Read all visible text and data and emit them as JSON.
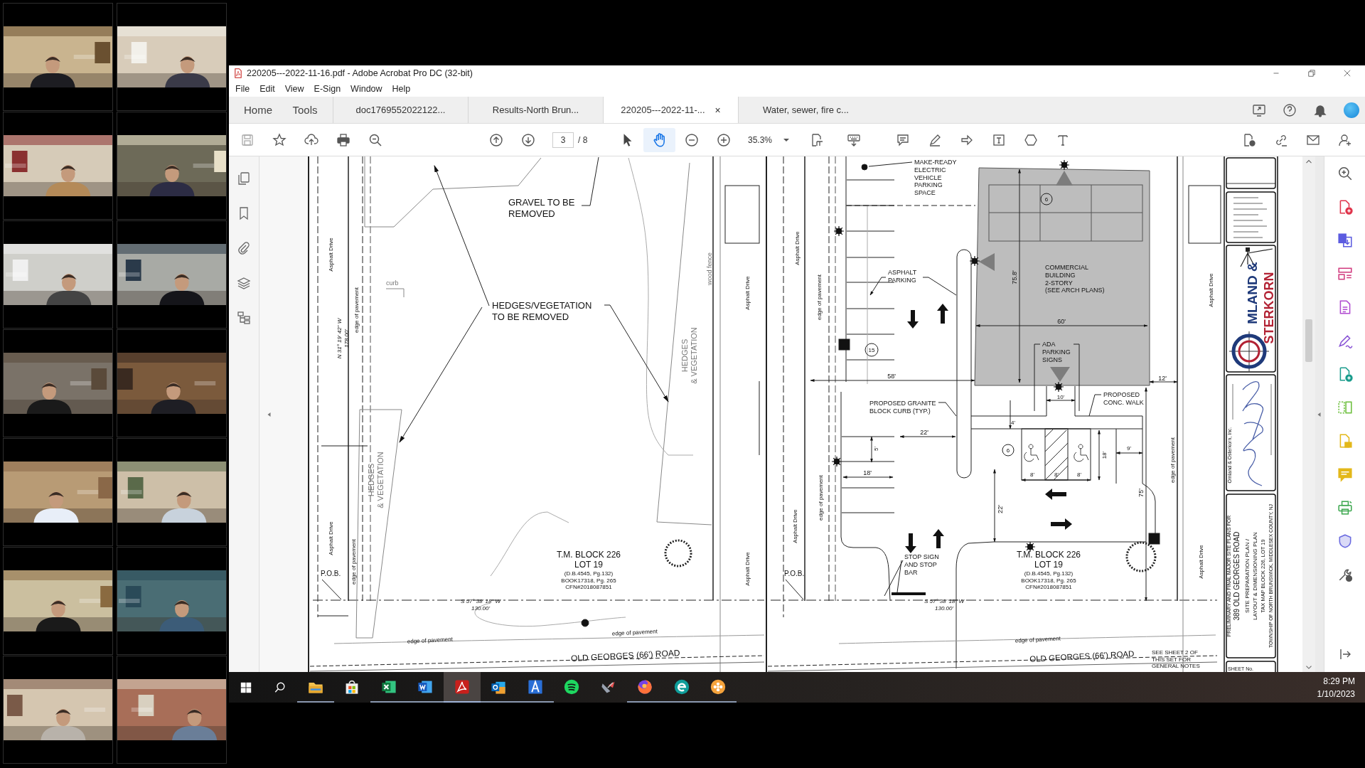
{
  "participants": [
    {
      "kind": "picture"
    },
    {
      "kind": "picture"
    },
    {
      "kind": "picture"
    },
    {
      "kind": "picture"
    },
    {
      "kind": "picture"
    },
    {
      "kind": "picture"
    },
    {
      "kind": "picture"
    },
    {
      "kind": "picture"
    },
    {
      "kind": "picture"
    },
    {
      "kind": "picture"
    },
    {
      "kind": "picture"
    },
    {
      "kind": "picture"
    },
    {
      "kind": "picture"
    },
    {
      "kind": "picture"
    }
  ],
  "window": {
    "title": "220205---2022-11-16.pdf - Adobe Acrobat Pro DC (32-bit)"
  },
  "menu": [
    "File",
    "Edit",
    "View",
    "E-Sign",
    "Window",
    "Help"
  ],
  "nav": [
    "Home",
    "Tools"
  ],
  "tabs": [
    {
      "label": "doc1769552022122...",
      "selected": false
    },
    {
      "label": "Results-North Brun...",
      "selected": false
    },
    {
      "label": "220205---2022-11-...",
      "selected": true,
      "close": "×"
    },
    {
      "label": "Water, sewer, fire c...",
      "selected": false
    }
  ],
  "toolbar": {
    "page": "3",
    "page_count": "/ 8",
    "zoom": "35.3%",
    "tools": [
      {
        "kind": "select",
        "selected": false
      },
      {
        "kind": "hand",
        "selected": true
      }
    ]
  },
  "document": {
    "site_plan": {
      "labels": [
        {
          "lines": [
            "GRAVEL TO BE",
            "REMOVED"
          ]
        },
        {
          "lines": [
            "HEDGES/VEGETATION",
            "TO BE REMOVED"
          ]
        },
        {
          "lines": [
            "HEDGES",
            "& VEGETATION"
          ]
        },
        {
          "lines": [
            "HEDGES",
            "& VEGETATION"
          ]
        },
        {
          "lines": [
            "curb"
          ]
        },
        {
          "lines": [
            "wood fence"
          ]
        },
        {
          "lines": [
            "P.O.B."
          ]
        },
        {
          "lines": [
            "T.M.  BLOCK 226",
            "LOT 19"
          ]
        },
        {
          "lines": [
            "(D.B.4545, Pg.132)",
            "BOOK17318, Pg. 265",
            "CFN#2018087851"
          ]
        },
        {
          "lines": [
            "S 57° 38' 18\" W",
            "130.00'"
          ]
        },
        {
          "lines": [
            "OLD GEORGES (66') ROAD"
          ]
        },
        {
          "lines": [
            "N 31° 19' 42\" W",
            "178.00'"
          ]
        },
        {
          "lines": [
            "Asphalt Drive"
          ]
        },
        {
          "lines": [
            "Asphalt Drive"
          ]
        },
        {
          "lines": [
            "Asphalt Drive"
          ]
        },
        {
          "lines": [
            "Asphalt Drive"
          ]
        },
        {
          "lines": [
            "edge of pavement"
          ]
        },
        {
          "lines": [
            "edge of pavement"
          ]
        },
        {
          "lines": [
            "edge of pavement"
          ]
        },
        {
          "lines": [
            "edge of pavement"
          ]
        }
      ]
    },
    "layout_plan": {
      "labels": [
        {
          "lines": [
            "MAKE-READY",
            "ELECTRIC",
            "VEHICLE",
            "PARKING",
            "SPACE"
          ]
        },
        {
          "lines": [
            "ASPHALT",
            "PARKING"
          ]
        },
        {
          "lines": [
            "COMMERCIAL",
            "BUILDING",
            "2-STORY",
            "(SEE ARCH PLANS)"
          ]
        },
        {
          "lines": [
            "75.8'"
          ]
        },
        {
          "lines": [
            "60'"
          ]
        },
        {
          "lines": [
            "ADA",
            "PARKING",
            "SIGNS"
          ]
        },
        {
          "lines": [
            "58'"
          ]
        },
        {
          "lines": [
            "12'"
          ]
        },
        {
          "lines": [
            "PROPOSED GRANITE",
            "BLOCK CURB (TYP.)"
          ]
        },
        {
          "lines": [
            "10'"
          ]
        },
        {
          "lines": [
            "PROPOSED",
            "CONC. WALK"
          ]
        },
        {
          "lines": [
            "4'"
          ]
        },
        {
          "lines": [
            "22'"
          ]
        },
        {
          "lines": [
            "5'"
          ]
        },
        {
          "lines": [
            "18'"
          ]
        },
        {
          "lines": [
            "8'"
          ]
        },
        {
          "lines": [
            "8'"
          ]
        },
        {
          "lines": [
            "8'"
          ]
        },
        {
          "lines": [
            "18'"
          ]
        },
        {
          "lines": [
            "9'"
          ]
        },
        {
          "lines": [
            "75'"
          ]
        },
        {
          "lines": [
            "22'"
          ]
        },
        {
          "lines": [
            "6"
          ]
        },
        {
          "lines": [
            "6"
          ]
        },
        {
          "lines": [
            "15"
          ]
        },
        {
          "lines": [
            "P.O.B."
          ]
        },
        {
          "lines": [
            "STOP SIGN",
            "AND STOP",
            "BAR"
          ]
        },
        {
          "lines": [
            "T.M.  BLOCK 226",
            "LOT 19"
          ]
        },
        {
          "lines": [
            "(D.B.4545, Pg.132)",
            "BOOK17318, Pg. 265",
            "CFN#2018087851"
          ]
        },
        {
          "lines": [
            "S 57° 38' 18\" W",
            "130.00'"
          ]
        },
        {
          "lines": [
            "OLD GEORGES (66') ROAD"
          ]
        },
        {
          "lines": [
            "SEE SHEET 2 OF",
            "THIS SET FOR",
            "GENERAL NOTES"
          ]
        },
        {
          "lines": [
            "Asphalt Drive"
          ]
        },
        {
          "lines": [
            "Asphalt Drive"
          ]
        },
        {
          "lines": [
            "Asphalt Drive"
          ]
        },
        {
          "lines": [
            "Asphalt Drive"
          ]
        },
        {
          "lines": [
            "edge of pavement"
          ]
        },
        {
          "lines": [
            "edge of pavement"
          ]
        },
        {
          "lines": [
            "edge of pavement"
          ]
        },
        {
          "lines": [
            "edge of pavement"
          ]
        }
      ]
    },
    "title_block": {
      "labels": [
        {
          "lines": [
            "PRELIMINARY AND FINAL MAJOR SITE PLANS FOR"
          ]
        },
        {
          "lines": [
            "389 OLD GEORGES ROAD"
          ]
        },
        {
          "lines": [
            "SITE PREPARATION PLAN /"
          ]
        },
        {
          "lines": [
            "LAYOUT & DIMENSIONING PLAN"
          ]
        },
        {
          "lines": [
            "TAX MAP BLOCK 226, LOT 19"
          ]
        },
        {
          "lines": [
            "TOWNSHIP OF NORTH BRUNSWICK, MIDDLESEX COUNTY, NJ"
          ]
        },
        {
          "lines": [
            "Omland & Osterkorn, Inc."
          ]
        },
        {
          "lines": [
            "MLAND &"
          ]
        },
        {
          "lines": [
            "STERKORN"
          ]
        },
        {
          "lines": [
            "SHEET No."
          ]
        }
      ]
    }
  },
  "taskbar": {
    "apps": [
      {
        "kind": "files",
        "running": true,
        "selected": false
      },
      {
        "kind": "store",
        "running": false,
        "selected": false
      },
      {
        "kind": "spreadsheet",
        "running": true,
        "selected": false
      },
      {
        "kind": "word",
        "running": true,
        "selected": false
      },
      {
        "kind": "pdf",
        "running": true,
        "selected": true
      },
      {
        "kind": "mail",
        "running": true,
        "selected": false
      },
      {
        "kind": "font",
        "running": true,
        "selected": false
      },
      {
        "kind": "music",
        "running": false,
        "selected": false
      },
      {
        "kind": "satellite",
        "running": false,
        "selected": false
      },
      {
        "kind": "browser",
        "running": true,
        "selected": false
      },
      {
        "kind": "edge",
        "running": true,
        "selected": false
      },
      {
        "kind": "flower",
        "running": true,
        "selected": false
      }
    ],
    "time": "8:29 PM",
    "date": "1/10/2023"
  }
}
